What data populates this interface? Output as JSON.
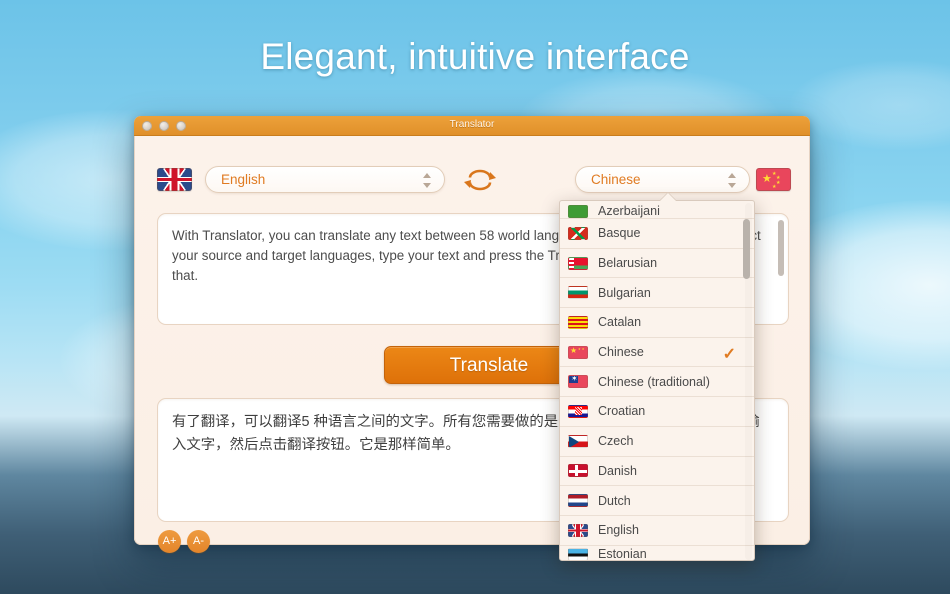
{
  "headline": "Elegant, intuitive interface",
  "window": {
    "title": "Translator",
    "traffic_lights": [
      "close",
      "minimize",
      "zoom"
    ]
  },
  "language_bar": {
    "source": {
      "flag": "uk-flag",
      "value": "English"
    },
    "swap_icon": "swap-arrows-icon",
    "target": {
      "flag": "china-flag",
      "value": "Chinese"
    }
  },
  "source_text": "With Translator, you can translate any text between 58 world languages. All you have to do is select your source and target languages, type your text and press the Translate button. It's as simple as that.",
  "translate_button": "Translate",
  "target_text": "有了翻译，可以翻译5 种语言之间的文字。所有您需要做的是选择您的源语言和目标语言，输入文字，然后点击翻译按钮。它是那样简单。",
  "font_controls": {
    "increase": "A+",
    "decrease": "A-"
  },
  "dropdown": {
    "selected": "Chinese",
    "check_color": "#e07b22",
    "items": [
      {
        "label": "Azerbaijani",
        "flag": "azerbaijan-flag",
        "state": "partial-top",
        "selected": false
      },
      {
        "label": "Basque",
        "flag": "basque-flag",
        "state": "full",
        "selected": false
      },
      {
        "label": "Belarusian",
        "flag": "belarus-flag",
        "state": "full",
        "selected": false
      },
      {
        "label": "Bulgarian",
        "flag": "bulgaria-flag",
        "state": "full",
        "selected": false
      },
      {
        "label": "Catalan",
        "flag": "catalan-flag",
        "state": "full",
        "selected": false
      },
      {
        "label": "Chinese",
        "flag": "china-flag",
        "state": "full",
        "selected": true
      },
      {
        "label": "Chinese (traditional)",
        "flag": "taiwan-flag",
        "state": "full",
        "selected": false
      },
      {
        "label": "Croatian",
        "flag": "croatia-flag",
        "state": "full",
        "selected": false
      },
      {
        "label": "Czech",
        "flag": "czech-flag",
        "state": "full",
        "selected": false
      },
      {
        "label": "Danish",
        "flag": "denmark-flag",
        "state": "full",
        "selected": false
      },
      {
        "label": "Dutch",
        "flag": "netherlands-flag",
        "state": "full",
        "selected": false
      },
      {
        "label": "English",
        "flag": "uk-flag",
        "state": "full",
        "selected": false
      },
      {
        "label": "Estonian",
        "flag": "estonia-flag",
        "state": "partial-bottom",
        "selected": false
      }
    ],
    "checkmark_glyph": "✓"
  },
  "colors": {
    "titlebar": "#e0902a",
    "accent_orange": "#e07b22",
    "translate_button": "#de7109",
    "window_bg": "#fbf0e7",
    "sky_top": "#6cc3e8"
  }
}
